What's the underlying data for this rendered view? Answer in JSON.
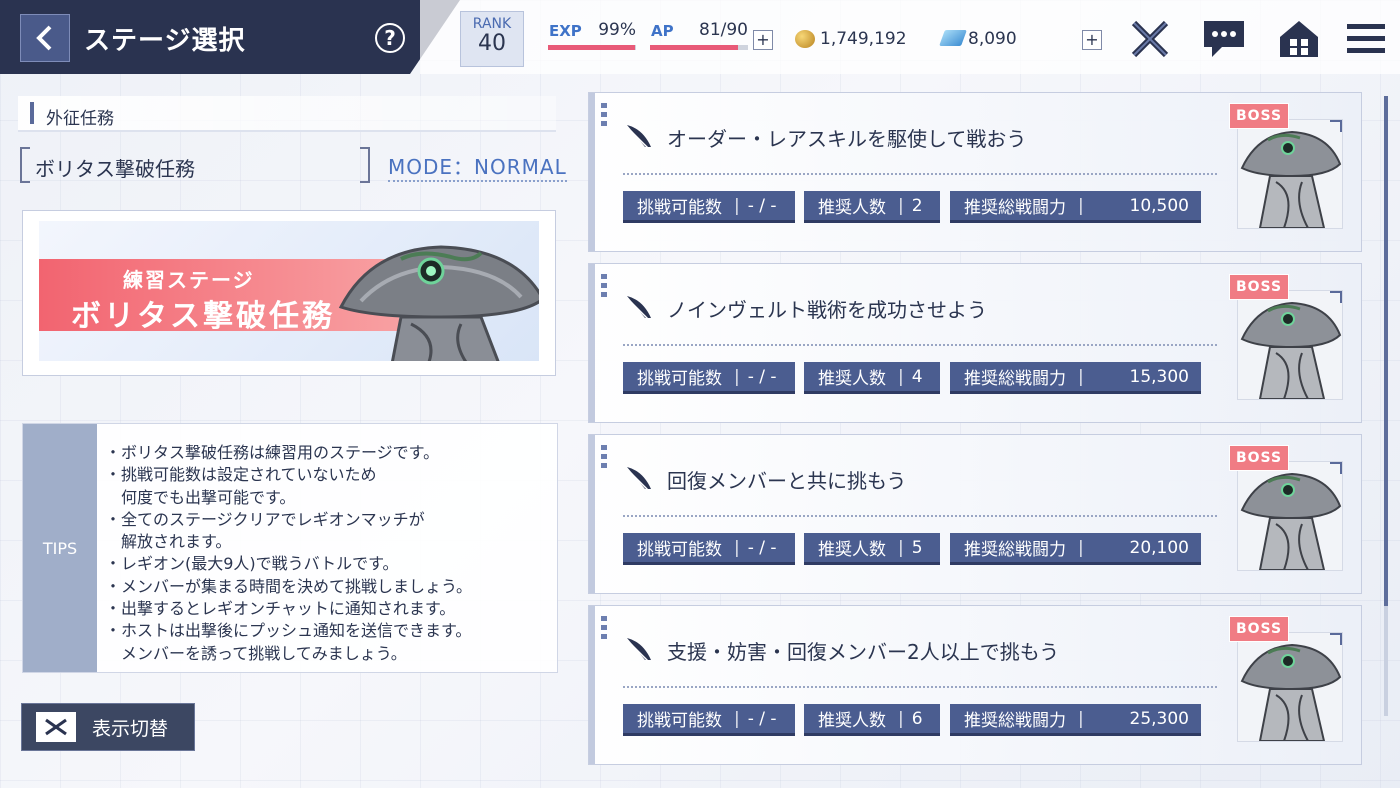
{
  "header": {
    "title": "ステージ選択",
    "help_icon": "?",
    "rank_label": "RANK",
    "rank_value": "40",
    "exp_label": "EXP",
    "exp_value": "99%",
    "exp_progress": 0.99,
    "ap_label": "AP",
    "ap_value": "81/90",
    "ap_progress": 0.9,
    "plus": "+",
    "coins": "1,749,192",
    "gems": "8,090",
    "icons": [
      "back-icon",
      "help-icon",
      "coin-icon",
      "gem-icon",
      "crossed-swords-icon",
      "chat-icon",
      "home-icon",
      "menu-icon"
    ]
  },
  "left": {
    "section_title": "外征任務",
    "mission_name": "ボリタス撃破任務",
    "mode": "MODE：NORMAL",
    "banner_sub": "練習ステージ",
    "banner_main": "ボリタス撃破任務",
    "tips_label": "TIPS",
    "tips": [
      "・ボリタス撃破任務は練習用のステージです。",
      "・挑戦可能数は設定されていないため",
      "　何度でも出撃可能です。",
      "・全てのステージクリアでレギオンマッチが",
      "　解放されます。",
      "・レギオン(最大9人)で戦うバトルです。",
      "・メンバーが集まる時間を決めて挑戦しましょう。",
      "・出撃するとレギオンチャットに通知されます。",
      "・ホストは出撃後にプッシュ通知を送信できます。",
      "　メンバーを誘って挑戦してみましょう。"
    ],
    "toggle_label": "表示切替"
  },
  "stages": [
    {
      "title": "オーダー・レアスキルを駆使して戦おう",
      "tries_label": "挑戦可能数",
      "tries": "- / -",
      "players_label": "推奨人数",
      "players": "2",
      "power_label": "推奨総戦闘力",
      "power": "10,500",
      "boss": "BOSS"
    },
    {
      "title": "ノインヴェルト戦術を成功させよう",
      "tries_label": "挑戦可能数",
      "tries": "- / -",
      "players_label": "推奨人数",
      "players": "4",
      "power_label": "推奨総戦闘力",
      "power": "15,300",
      "boss": "BOSS"
    },
    {
      "title": "回復メンバーと共に挑もう",
      "tries_label": "挑戦可能数",
      "tries": "- / -",
      "players_label": "推奨人数",
      "players": "5",
      "power_label": "推奨総戦闘力",
      "power": "20,100",
      "boss": "BOSS"
    },
    {
      "title": "支援・妨害・回復メンバー2人以上で挑もう",
      "tries_label": "挑戦可能数",
      "tries": "- / -",
      "players_label": "推奨人数",
      "players": "6",
      "power_label": "推奨総戦闘力",
      "power": "25,300",
      "boss": "BOSS"
    }
  ]
}
